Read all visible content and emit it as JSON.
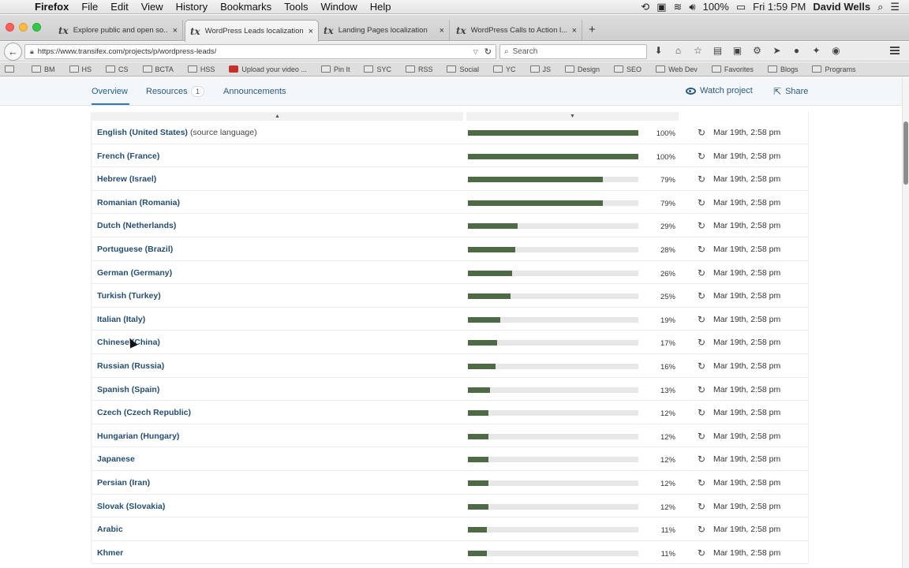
{
  "menubar": {
    "app": "Firefox",
    "items": [
      "File",
      "Edit",
      "View",
      "History",
      "Bookmarks",
      "Tools",
      "Window",
      "Help"
    ],
    "battery": "100%",
    "clock": "Fri 1:59 PM",
    "user": "David Wells"
  },
  "tabs": [
    {
      "label": "Explore public and open so...",
      "active": false
    },
    {
      "label": "WordPress Leads localization",
      "active": true
    },
    {
      "label": "Landing Pages localization",
      "active": false
    },
    {
      "label": "WordPress Calls to Action l...",
      "active": false
    }
  ],
  "navbar": {
    "url": "https://www.transifex.com/projects/p/wordpress-leads/",
    "search_placeholder": "Search"
  },
  "bookmarks": [
    "BM",
    "HS",
    "CS",
    "BCTA",
    "HSS",
    "Upload your video ...",
    "Pin It",
    "SYC",
    "RSS",
    "Social",
    "YC",
    "JS",
    "Design",
    "SEO",
    "Web Dev",
    "Favorites",
    "Blogs",
    "Programs"
  ],
  "subnav": {
    "overview": "Overview",
    "resources": "Resources",
    "resources_count": "1",
    "announcements": "Announcements",
    "watch": "Watch project",
    "share": "Share"
  },
  "table": {
    "sort_asc": "▲",
    "sort_desc": "▼",
    "source_note": "(source language)",
    "rows": [
      {
        "language": "English (United States)",
        "source": true,
        "percent": 100,
        "percent_label": "100%",
        "date": "Mar 19th, 2:58 pm"
      },
      {
        "language": "French (France)",
        "percent": 100,
        "percent_label": "100%",
        "date": "Mar 19th, 2:58 pm"
      },
      {
        "language": "Hebrew (Israel)",
        "percent": 79,
        "percent_label": "79%",
        "date": "Mar 19th, 2:58 pm"
      },
      {
        "language": "Romanian (Romania)",
        "percent": 79,
        "percent_label": "79%",
        "date": "Mar 19th, 2:58 pm"
      },
      {
        "language": "Dutch (Netherlands)",
        "percent": 29,
        "percent_label": "29%",
        "date": "Mar 19th, 2:58 pm"
      },
      {
        "language": "Portuguese (Brazil)",
        "percent": 28,
        "percent_label": "28%",
        "date": "Mar 19th, 2:58 pm"
      },
      {
        "language": "German (Germany)",
        "percent": 26,
        "percent_label": "26%",
        "date": "Mar 19th, 2:58 pm"
      },
      {
        "language": "Turkish (Turkey)",
        "percent": 25,
        "percent_label": "25%",
        "date": "Mar 19th, 2:58 pm"
      },
      {
        "language": "Italian (Italy)",
        "percent": 19,
        "percent_label": "19%",
        "date": "Mar 19th, 2:58 pm"
      },
      {
        "language": "Chinese (China)",
        "percent": 17,
        "percent_label": "17%",
        "date": "Mar 19th, 2:58 pm"
      },
      {
        "language": "Russian (Russia)",
        "percent": 16,
        "percent_label": "16%",
        "date": "Mar 19th, 2:58 pm"
      },
      {
        "language": "Spanish (Spain)",
        "percent": 13,
        "percent_label": "13%",
        "date": "Mar 19th, 2:58 pm"
      },
      {
        "language": "Czech (Czech Republic)",
        "percent": 12,
        "percent_label": "12%",
        "date": "Mar 19th, 2:58 pm"
      },
      {
        "language": "Hungarian (Hungary)",
        "percent": 12,
        "percent_label": "12%",
        "date": "Mar 19th, 2:58 pm"
      },
      {
        "language": "Japanese",
        "percent": 12,
        "percent_label": "12%",
        "date": "Mar 19th, 2:58 pm"
      },
      {
        "language": "Persian (Iran)",
        "percent": 12,
        "percent_label": "12%",
        "date": "Mar 19th, 2:58 pm"
      },
      {
        "language": "Slovak (Slovakia)",
        "percent": 12,
        "percent_label": "12%",
        "date": "Mar 19th, 2:58 pm"
      },
      {
        "language": "Arabic",
        "percent": 11,
        "percent_label": "11%",
        "date": "Mar 19th, 2:58 pm"
      },
      {
        "language": "Khmer",
        "percent": 11,
        "percent_label": "11%",
        "date": "Mar 19th, 2:58 pm"
      }
    ]
  },
  "colors": {
    "progress_fill": "#4d6a45",
    "link": "#254e71",
    "accent": "#2a79bd"
  }
}
